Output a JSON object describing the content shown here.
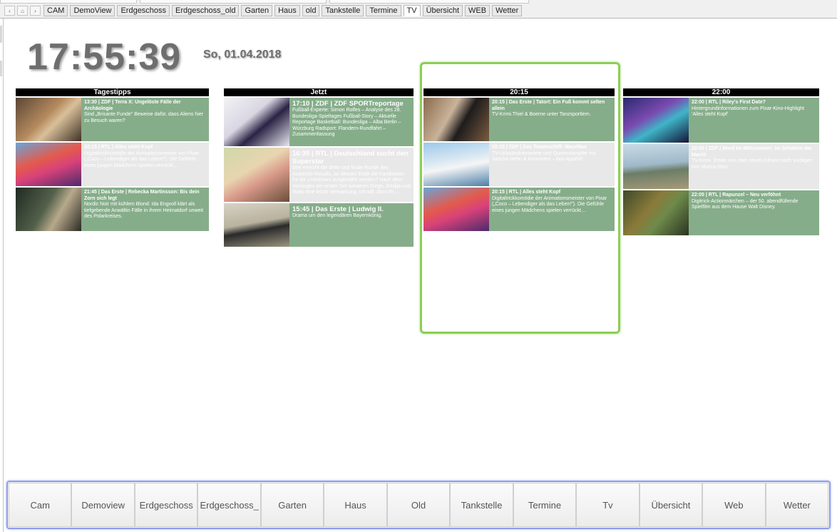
{
  "topbar": {
    "tabs": [
      "CAM",
      "DemoView",
      "Erdgeschoss",
      "Erdgeschoss_old",
      "Garten",
      "Haus",
      "old",
      "Tankstelle",
      "Termine",
      "TV",
      "Übersicht",
      "WEB",
      "Wetter"
    ],
    "active_tab": "TV",
    "nav_icons": [
      "chevron-left-icon",
      "home-icon",
      "chevron-right-icon"
    ]
  },
  "clock": {
    "time": "17:55:39",
    "date": "So, 01.04.2018"
  },
  "columns": [
    {
      "header": "Tagestipps",
      "items": [
        {
          "title": "13:30 | ZDF | Terra X: Ungelöste Fälle der Archäologie",
          "text": "Sind „Brisante Funde\" Beweise dafür, dass Aliens hier zu Besuch waren?"
        },
        {
          "title": "20:15 | RTL | Alles steht Kopf",
          "text": "Digitaltrickkomödie der Animationsmeister von Pixar („Coco – Lebendiger als das Leben!\"). Die Gefühle eines jungen Mädchens spielen verrückt…"
        },
        {
          "title": "21:45 | Das Erste | Rebecka Martinsson: Bis dein Zorn sich legt",
          "text": "Nordic Noir mit kühlem Blond: Ida Engvoll klärt als tiefgebende Anwältin Fälle in ihrem Heimatdorf unweit des Polarkreises."
        }
      ]
    },
    {
      "header": "Jetzt",
      "items": [
        {
          "title": "17:10 | ZDF | ZDF SPORTreportage",
          "text": "Fußball-Experte: Simon Rolfes – Analyse des 28. Bundesliga-Spieltages Fußball-Story – Aktuelle Reportage Basketball: Bundesliga – Alba Berlin – Würzburg Radsport: Flandern-Rundfahrt – Zusammenfassung"
        },
        {
          "title": "16:35 | RTL | Deutschland sucht den Superstar",
          "text": "Wer erreicht die dritte und finale Runde des Auslands-Recalls, an dessen Ende die Kandidaten für die Liveshows ausgewählt werden? Nach dem Vorsingen am ersten Set bekamen Diego, Emilija und Maily eine letzte Verwarnung. Ich will, dass ihr…"
        },
        {
          "title": "15:45 | Das Erste | Ludwig II.",
          "text": "Drama um den legendären Bayernkönig."
        }
      ]
    },
    {
      "header": "20:15",
      "items": [
        {
          "title": "20:15 | Das Erste | Tatort: Ein Fuß kommt selten allein",
          "text": "TV-Krimi.Thiel & Boerne unter Tanzsportlern."
        },
        {
          "title": "20:15 | ZDF | Das Traumschiff: Mauritius",
          "text": "TV-Urlaubsdramaserie und Quotendampfer mit Sascha Hehn & Konsorten – bon Appétit!"
        },
        {
          "title": "20:15 | RTL | Alles steht Kopf",
          "text": "Digitaltrickkomödie der Animationsmeister von Pixar („Coco – Lebendiger als das Leben!\"). Die Gefühle eines jungen Mädchens spielen verrückt…"
        }
      ]
    },
    {
      "header": "22:00",
      "items": [
        {
          "title": "22:00 | RTL | Riley's First Date?",
          "text": "Hintergrundinformationen zum Pixar-Kino-Highlight 'Alles steht Kopf'"
        },
        {
          "title": "22:00 | ZDF | Mord im Mittsommer: Im Schatten der Macht",
          "text": "TV-Krimi. Erster von zwei neuen Filmen nach Vorlagen von Viveca Sten."
        },
        {
          "title": "22:05 | RTL | Rapunzel – Neu verföhnt",
          "text": "Digitrick-Actionmärchen – der 50. abendfüllende Spielfilm aus dem Hause Walt Disney."
        }
      ]
    }
  ],
  "bottomnav": [
    "Cam",
    "Demoview",
    "Erdgeschoss",
    "Erdgeschoss_",
    "Garten",
    "Haus",
    "Old",
    "Tankstelle",
    "Termine",
    "Tv",
    "Übersicht",
    "Web",
    "Wetter"
  ]
}
